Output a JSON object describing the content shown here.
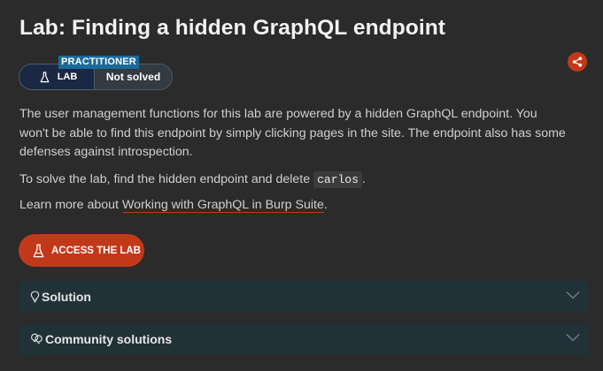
{
  "title": "Lab: Finding a hidden GraphQL endpoint",
  "level": "PRACTITIONER",
  "badge": {
    "lab_label": "LAB",
    "status": "Not solved"
  },
  "intro": "The user management functions for this lab are powered by a hidden GraphQL endpoint. You won't be able to find this endpoint by simply clicking pages in the site. The endpoint also has some defenses against introspection.",
  "goal": {
    "before": "To solve the lab, find the hidden endpoint and delete ",
    "code": "carlos",
    "after": "."
  },
  "learn": {
    "before": "Learn more about ",
    "link": "Working with GraphQL in Burp Suite",
    "after": "."
  },
  "access_button": "ACCESS THE LAB",
  "panels": [
    {
      "label": "Solution",
      "icon": "lightbulb-icon"
    },
    {
      "label": "Community solutions",
      "icon": "community-icon"
    }
  ],
  "icons": {
    "share": "share-icon",
    "flask": "flask-icon",
    "chevron": "chevron-down-icon"
  },
  "colors": {
    "background": "#2b2b2b",
    "accent": "#c2391a",
    "level_tag": "#1b6a99",
    "panel": "#213138",
    "badge_lab": "#1b2844"
  }
}
